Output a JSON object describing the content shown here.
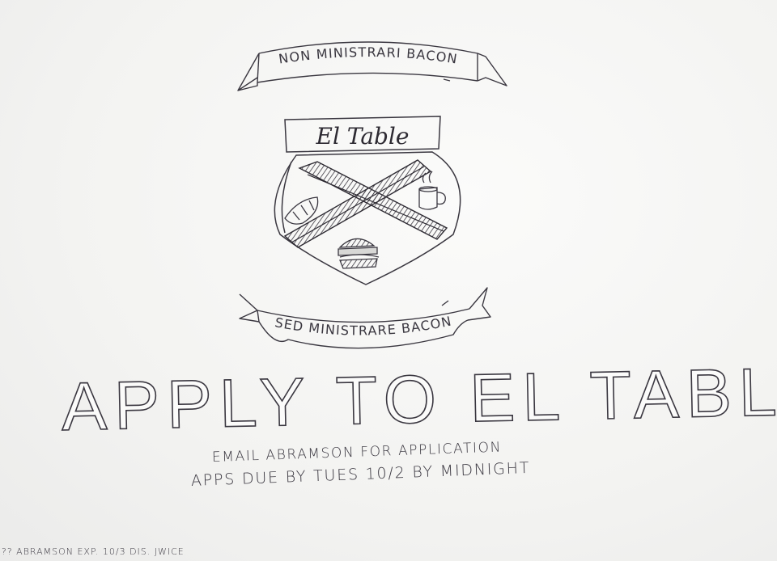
{
  "top_banner": {
    "motto": "NON MINISTRARI BACON"
  },
  "crest": {
    "title_plaque": "El Table",
    "charges": [
      "croissant-icon",
      "coffee-mug-icon",
      "sandwich-icon",
      "bacon-strips-icon"
    ]
  },
  "bottom_banner": {
    "motto": "SED MINISTRARE BACON"
  },
  "headline": "APPLY TO EL TABLE",
  "details": {
    "email": "EMAIL ABRAMSON FOR APPLICATION",
    "deadline": "APPS DUE BY TUES 10/2 BY MIDNIGHT"
  },
  "footer_note": "?? ABRAMSON EXP. 10/3 DIS. JWICE",
  "colors": {
    "paper": "#f4f4f2",
    "ink": "#3a3740"
  }
}
